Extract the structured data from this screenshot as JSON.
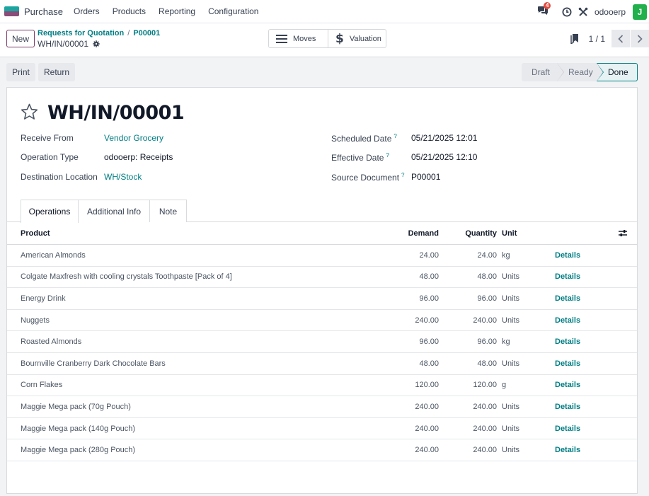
{
  "navbar": {
    "app_name": "Purchase",
    "menu": [
      "Orders",
      "Products",
      "Reporting",
      "Configuration"
    ],
    "chat_badge": "4",
    "user_name": "odooerp",
    "avatar_letter": "J"
  },
  "control": {
    "new_label": "New",
    "breadcrumb": [
      "Requests for Quotation",
      "P00001"
    ],
    "record_name": "WH/IN/00001",
    "smart_buttons": [
      {
        "label": "Moves",
        "icon": "list-icon"
      },
      {
        "label": "Valuation",
        "icon": "dollar-icon"
      }
    ],
    "pager": "1 / 1"
  },
  "actions": {
    "print_label": "Print",
    "return_label": "Return"
  },
  "statusbar": {
    "stages": [
      "Draft",
      "Ready",
      "Done"
    ],
    "current": "Done"
  },
  "form": {
    "title": "WH/IN/00001",
    "left_fields": [
      {
        "label": "Receive From",
        "value": "Vendor Grocery"
      },
      {
        "label": "Operation Type",
        "value": "odooerp: Receipts"
      },
      {
        "label": "Destination Location",
        "value": "WH/Stock"
      }
    ],
    "right_fields": [
      {
        "label": "Scheduled Date",
        "value": "05/21/2025 12:01"
      },
      {
        "label": "Effective Date",
        "value": "05/21/2025 12:10"
      },
      {
        "label": "Source Document",
        "value": "P00001"
      }
    ],
    "help_mark": "?"
  },
  "tabs": [
    "Operations",
    "Additional Info",
    "Note"
  ],
  "table": {
    "headers": {
      "product": "Product",
      "demand": "Demand",
      "quantity": "Quantity",
      "unit": "Unit"
    },
    "details_label": "Details",
    "rows": [
      {
        "product": "American Almonds",
        "demand": "24.00",
        "quantity": "24.00",
        "unit": "kg"
      },
      {
        "product": "Colgate Maxfresh with cooling crystals Toothpaste [Pack of 4]",
        "demand": "48.00",
        "quantity": "48.00",
        "unit": "Units"
      },
      {
        "product": "Energy Drink",
        "demand": "96.00",
        "quantity": "96.00",
        "unit": "Units"
      },
      {
        "product": "Nuggets",
        "demand": "240.00",
        "quantity": "240.00",
        "unit": "Units"
      },
      {
        "product": "Roasted Almonds",
        "demand": "96.00",
        "quantity": "96.00",
        "unit": "kg"
      },
      {
        "product": "Bournville Cranberry Dark Chocolate Bars",
        "demand": "48.00",
        "quantity": "48.00",
        "unit": "Units"
      },
      {
        "product": "Corn Flakes",
        "demand": "120.00",
        "quantity": "120.00",
        "unit": "g"
      },
      {
        "product": "Maggie Mega pack (70g Pouch)",
        "demand": "240.00",
        "quantity": "240.00",
        "unit": "Units"
      },
      {
        "product": "Maggie Mega pack (140g Pouch)",
        "demand": "240.00",
        "quantity": "240.00",
        "unit": "Units"
      },
      {
        "product": "Maggie Mega pack (280g Pouch)",
        "demand": "240.00",
        "quantity": "240.00",
        "unit": "Units"
      }
    ]
  },
  "colors": {
    "accent": "#017e84",
    "brand": "#7c3a68",
    "badge": "#e4493e",
    "avatar": "#21b04b"
  }
}
